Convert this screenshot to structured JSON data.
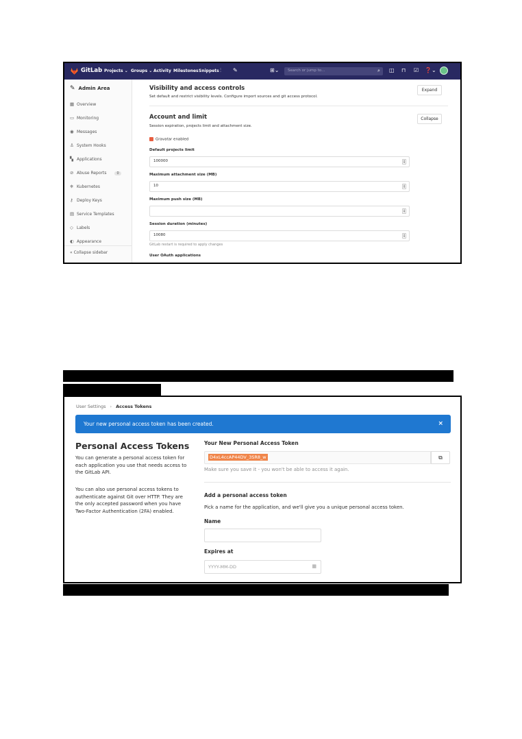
{
  "gitlab_admin": {
    "nav": {
      "brand": "GitLab",
      "links": [
        "Projects ⌄",
        "Groups ⌄",
        "Activity",
        "Milestones",
        "Snippets"
      ],
      "search_placeholder": "Search or jump to…",
      "icons": [
        "chart-icon",
        "wrench-icon",
        "plus-icon",
        "merge-requests-icon",
        "todos-icon",
        "help-icon",
        "avatar"
      ]
    },
    "sidebar": {
      "title": "Admin Area",
      "items": [
        {
          "label": "Overview",
          "icon": "overview-icon"
        },
        {
          "label": "Monitoring",
          "icon": "monitoring-icon"
        },
        {
          "label": "Messages",
          "icon": "messages-icon"
        },
        {
          "label": "System Hooks",
          "icon": "hooks-icon"
        },
        {
          "label": "Applications",
          "icon": "applications-icon"
        },
        {
          "label": "Abuse Reports",
          "icon": "abuse-icon",
          "count": "0"
        },
        {
          "label": "Kubernetes",
          "icon": "kubernetes-icon"
        },
        {
          "label": "Deploy Keys",
          "icon": "key-icon"
        },
        {
          "label": "Service Templates",
          "icon": "template-icon"
        },
        {
          "label": "Labels",
          "icon": "labels-icon"
        },
        {
          "label": "Appearance",
          "icon": "appearance-icon"
        }
      ],
      "collapse_label": "Collapse sidebar"
    },
    "main": {
      "visibility": {
        "title": "Visibility and access controls",
        "desc": "Set default and restrict visibility levels. Configure import sources and git access protocol.",
        "button": "Expand"
      },
      "account": {
        "title": "Account and limit",
        "desc": "Session expiration, projects limit and attachment size.",
        "button": "Collapse",
        "gravatar_label": "Gravatar enabled",
        "fields": [
          {
            "label": "Default projects limit",
            "value": "100000"
          },
          {
            "label": "Maximum attachment size (MB)",
            "value": "10"
          },
          {
            "label": "Maximum push size (MB)",
            "value": ""
          },
          {
            "label": "Session duration (minutes)",
            "value": "10080"
          }
        ],
        "help": "GitLab restart is required to apply changes",
        "next_label": "User OAuth applications"
      }
    }
  },
  "access_tokens": {
    "breadcrumb": [
      "User Settings",
      "Access Tokens"
    ],
    "alert": "Your new personal access token has been created.",
    "alert_close": "×",
    "left": {
      "title": "Personal Access Tokens",
      "para1": "You can generate a personal access token for each application you use that needs access to the GitLab API.",
      "para2": "You can also use personal access tokens to authenticate against Git over HTTP. They are the only accepted password when you have Two-Factor Authentication (2FA) enabled."
    },
    "right": {
      "new_token_title": "Your New Personal Access Token",
      "token": "D4xL4ccAP44DV_3SR8_w",
      "save_note": "Make sure you save it - you won't be able to access it again.",
      "add_title": "Add a personal access token",
      "add_desc": "Pick a name for the application, and we'll give you a unique personal access token.",
      "name_label": "Name",
      "name_value": "",
      "expires_label": "Expires at",
      "expires_placeholder": "YYYY-MM-DD"
    }
  },
  "colors": {
    "nav_bg": "#292961",
    "alert_bg": "#1f78d1",
    "token_highlight": "#f0854a",
    "checkbox": "#e75e40"
  }
}
